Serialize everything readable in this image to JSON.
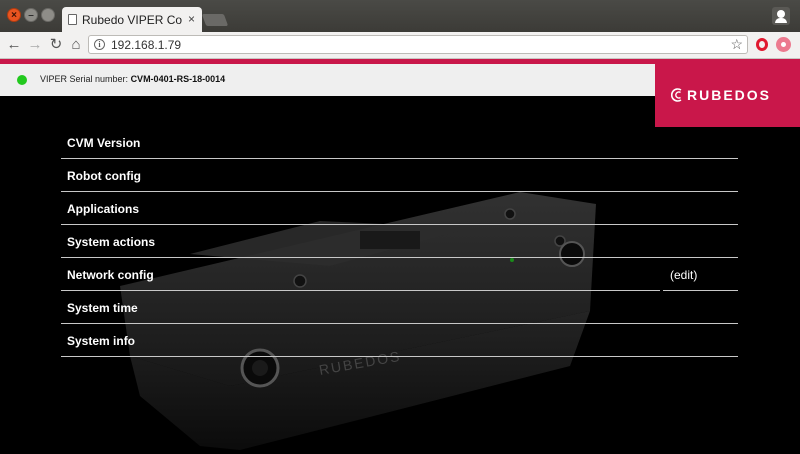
{
  "browser": {
    "tab_title": "Rubedo VIPER Conf",
    "address": "192.168.1.79"
  },
  "icons": {
    "close": "close-icon",
    "minimize": "minimize-icon",
    "maximize": "maximize-icon",
    "back": "back-arrow-icon",
    "forward": "forward-arrow-icon",
    "reload": "reload-icon",
    "home": "home-icon",
    "info": "info-icon",
    "bookmark": "star-icon",
    "opera": "opera-icon",
    "extension": "extension-icon",
    "profile": "profile-icon"
  },
  "header": {
    "serial_label": "VIPER Serial number:",
    "serial_value": "CVM-0401-RS-18-0014",
    "status": "online",
    "logo_text": "RUBEDOS"
  },
  "menu": {
    "items": [
      {
        "label": "CVM Version"
      },
      {
        "label": "Robot config"
      },
      {
        "label": "Applications"
      },
      {
        "label": "System actions"
      },
      {
        "label": "Network config",
        "action": "(edit)"
      },
      {
        "label": "System time"
      },
      {
        "label": "System info"
      }
    ]
  },
  "colors": {
    "accent": "#c9174a",
    "status_ok": "#22c91e",
    "page_bg": "#000000"
  }
}
